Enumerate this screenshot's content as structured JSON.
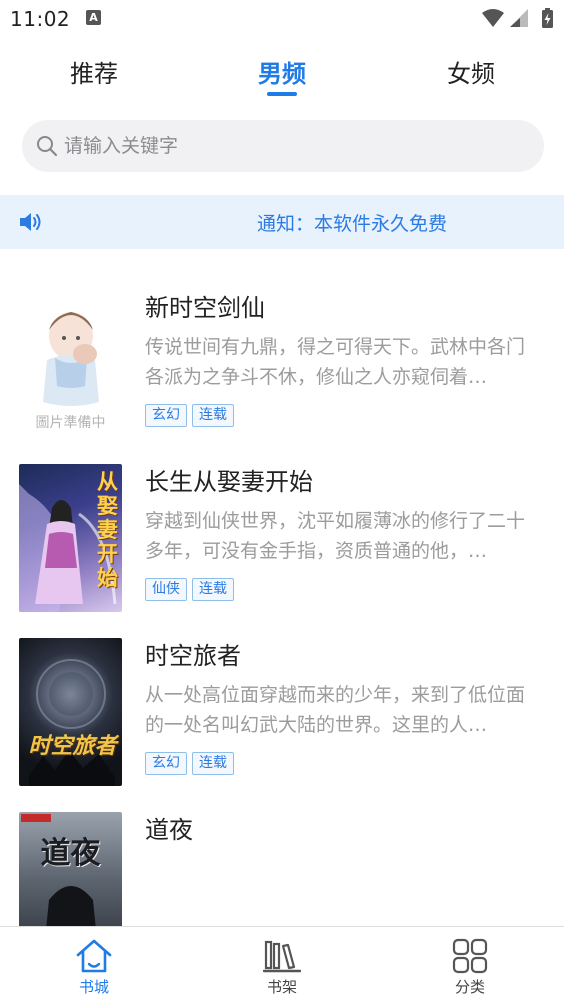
{
  "status_bar": {
    "time": "11:02",
    "notification_letter": "A"
  },
  "top_tabs": [
    {
      "label": "推荐",
      "active": false
    },
    {
      "label": "男频",
      "active": true
    },
    {
      "label": "女频",
      "active": false
    }
  ],
  "search": {
    "placeholder": "请输入关键字",
    "value": ""
  },
  "notice": {
    "text": "通知：本软件永久免费"
  },
  "books": [
    {
      "title": "新时空剑仙",
      "description": "传说世间有九鼎，得之可得天下。武林中各门各派为之争斗不休，修仙之人亦窥伺着…",
      "tags": [
        "玄幻",
        "连载"
      ],
      "cover_placeholder_text": "圖片準備中"
    },
    {
      "title": "长生从娶妻开始",
      "description": "穿越到仙侠世界，沈平如履薄冰的修行了二十多年，可没有金手指，资质普通的他，…",
      "tags": [
        "仙侠",
        "连载"
      ],
      "cover_text": "从娶妻开始"
    },
    {
      "title": "时空旅者",
      "description": "从一处高位面穿越而来的少年，来到了低位面的一处名叫幻武大陆的世界。这里的人…",
      "tags": [
        "玄幻",
        "连载"
      ],
      "cover_text": "时空旅者"
    },
    {
      "title": "道夜",
      "description": "",
      "tags": [],
      "cover_text": "道夜"
    }
  ],
  "bottom_nav": [
    {
      "label": "书城",
      "icon": "home-icon",
      "active": true
    },
    {
      "label": "书架",
      "icon": "bookshelf-icon",
      "active": false
    },
    {
      "label": "分类",
      "icon": "category-grid-icon",
      "active": false
    }
  ],
  "colors": {
    "accent": "#1f7be6",
    "notice_bg": "#e8f2fd",
    "tag_border": "#8fbfe8"
  }
}
